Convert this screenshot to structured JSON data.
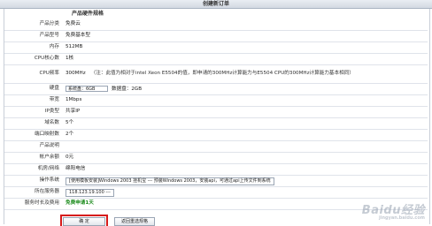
{
  "window": {
    "title": "创建新订单"
  },
  "section": {
    "title": "产品硬件规格"
  },
  "rows": [
    {
      "label": "产品分类",
      "value": "免费云"
    },
    {
      "label": "产品型号",
      "value": "免费基本型"
    },
    {
      "label": "内存",
      "value": "512MB"
    },
    {
      "label": "CPU核心数",
      "value": "1核"
    },
    {
      "label": "CPU频率",
      "value": "300MHz",
      "note": "（注：此值为相对于intel Xeon E5504的值，即申请的300MHz计算能力与E5504 CPU的300MHz计算能力基本相同）"
    },
    {
      "label": "硬盘",
      "value": "系统盘：6GB",
      "value2": "数据盘：2GB"
    },
    {
      "label": "带宽",
      "value": "1Mbps"
    },
    {
      "label": "IP类型",
      "value": "共享IP"
    },
    {
      "label": "域名数",
      "value": "5个"
    },
    {
      "label": "端口映射数",
      "value": "2个"
    },
    {
      "label": "产品说明",
      "value": ""
    },
    {
      "label": "帐户余额",
      "value": "0元"
    },
    {
      "label": "机房/网络",
      "value": "绵阳电信"
    },
    {
      "label": "操作系统",
      "value": "[使用模板安装]Windows 2003 挂机宝 --- 预装Windows 2003，安装api，可通过api上传文件到系统"
    },
    {
      "label": "所在服务器",
      "value": "118.123.19.100 ---"
    },
    {
      "label": "服务时长及费用",
      "value": "免费申请1天"
    }
  ],
  "buttons": {
    "ok": "确 定",
    "back": "返回重选规格"
  },
  "watermark": {
    "brand": "Baidu经验",
    "url": "jingyan.baidu.com"
  },
  "colors": {
    "highlight": "#d61a1a",
    "green_text": "#1a8a1a",
    "title_bar": "#d3d9e2"
  }
}
